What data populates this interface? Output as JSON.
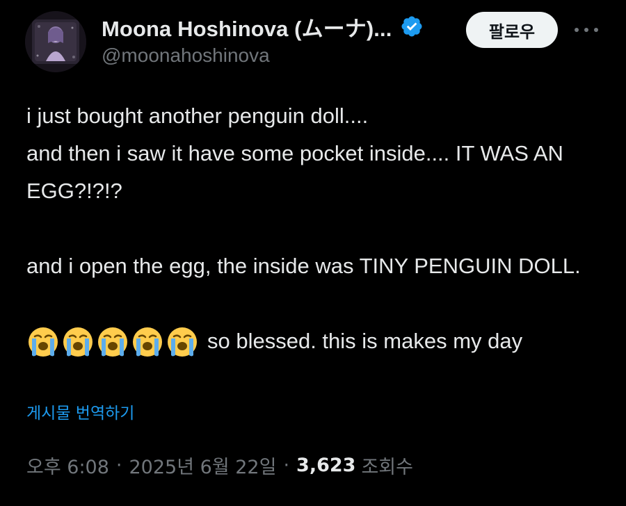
{
  "author": {
    "display_name": "Moona Hoshinova (ムーナ)...",
    "handle": "@moonahoshinova",
    "verified_icon": "verified-badge-icon",
    "avatar": "moona-avatar"
  },
  "actions": {
    "follow_label": "팔로우",
    "more_icon": "more-icon"
  },
  "tweet": {
    "lines": [
      "i just bought another penguin doll....",
      "and then i saw it have some pocket inside.... IT WAS AN EGG?!?!?",
      "and i open the egg, the inside was TINY PENGUIN DOLL."
    ],
    "emoji_name": "loudly-crying-face-emoji",
    "emoji_count": 5,
    "emoji_suffix": "so blessed. this is makes my day"
  },
  "translate_label": "게시물 번역하기",
  "meta": {
    "time": "오후 6:08",
    "date": "2025년 6월 22일",
    "views_count": "3,623",
    "views_label": "조회수",
    "separator": "·"
  },
  "colors": {
    "background": "#000000",
    "text": "#e7e9ea",
    "muted": "#71767b",
    "accent": "#1d9bf0"
  }
}
